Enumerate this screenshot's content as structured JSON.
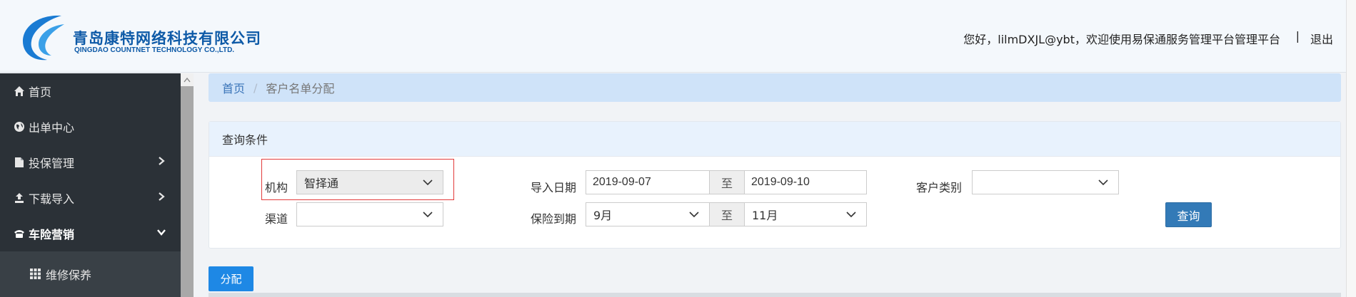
{
  "header": {
    "company_cn": "青岛康特网络科技有限公司",
    "company_en": "QINGDAO COUNTNET TECHNOLOGY CO.,LTD.",
    "welcome": "您好，lilmDXJL@ybt，欢迎使用易保通服务管理平台管理平台",
    "separator": "|",
    "logout": "退出",
    "brand_color": "#0e5aa7"
  },
  "sidebar": {
    "items": [
      {
        "label": "首页",
        "icon": "home-icon"
      },
      {
        "label": "出单中心",
        "icon": "globe-icon"
      },
      {
        "label": "投保管理",
        "icon": "file-icon",
        "expandable": true
      },
      {
        "label": "下载导入",
        "icon": "upload-icon",
        "expandable": true
      },
      {
        "label": "车险营销",
        "icon": "phone-icon",
        "expanded": true
      }
    ],
    "sub_items": [
      {
        "label": "维修保养",
        "icon": "grid-icon"
      }
    ]
  },
  "breadcrumb": {
    "home": "首页",
    "separator": "/",
    "current": "客户名单分配"
  },
  "query": {
    "title": "查询条件",
    "org_label": "机构",
    "org_value": "智择通",
    "channel_label": "渠道",
    "channel_value": "",
    "import_date_label": "导入日期",
    "import_date_from": "2019-09-07",
    "import_date_to": "2019-09-10",
    "to_label": "至",
    "expiry_label": "保险到期",
    "expiry_from": "9月",
    "expiry_to": "11月",
    "customer_type_label": "客户类别",
    "customer_type_value": "",
    "search_button": "查询"
  },
  "actions": {
    "assign_button": "分配"
  },
  "colors": {
    "sidebar_bg": "#2b3137",
    "primary_button": "#337ab7",
    "assign_button": "#1e88e5",
    "highlight": "#e23b3b"
  }
}
